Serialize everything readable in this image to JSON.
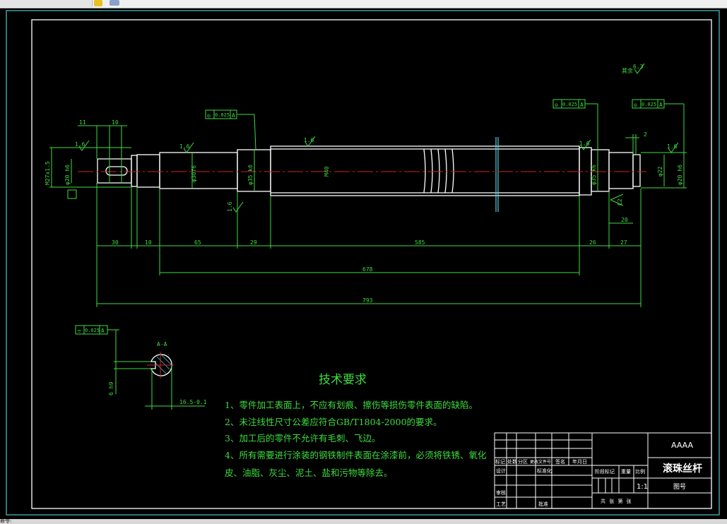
{
  "status_text": "命令:",
  "drawing": {
    "dimensions": {
      "d30": "30",
      "d10": "10",
      "d65": "65",
      "d29": "29",
      "d585": "585",
      "d26": "26",
      "d27": "27",
      "d678": "678",
      "d793": "793",
      "d11": "11",
      "d10top": "10",
      "d2": "2",
      "d20": "20",
      "d_thread": "M27x1.5",
      "d_phi20": "φ20 h6",
      "d_phi30": "φ30f6",
      "d_phi35a": "φ35 k6",
      "d_phi40": "M40",
      "d_phi35b": "φ35 k6",
      "d_phi22": "φ22",
      "d_phi20b": "φ20 h6",
      "keyway_width": "16.5-0.1",
      "keyway_depth": "6 h9"
    },
    "roughness": {
      "r1": "1.6",
      "r2": "1.6",
      "r3": "1.6",
      "r4": "1.6",
      "r5": "1.6",
      "r6": "1.6",
      "rest": "其余",
      "rest_val": "6.3",
      "chamfer": "C2"
    },
    "tolerances": {
      "t1": {
        "symbol": "◎",
        "value": "0.025",
        "datum": "A"
      },
      "t2": {
        "symbol": "◎",
        "value": "0.025",
        "datum": "A"
      },
      "t3": {
        "symbol": "◎",
        "value": "0.025",
        "datum": "A"
      },
      "t4": {
        "symbol": "⌯",
        "value": "0.025",
        "datum": "A"
      }
    },
    "datum_label": "A",
    "section_label": "A-A"
  },
  "tech_requirements": {
    "title": "技术要求",
    "items": [
      "1、零件加工表面上，不应有划痕、擦伤等损伤零件表面的缺陷。",
      "2、未注线性尺寸公差应符合GB/T1804-2000的要求。",
      "3、加工后的零件不允许有毛刺、飞边。",
      "4、所有需要进行涂装的钢铁制件表面在涂漆前，必须将铁锈、氧化",
      "皮、油脂、灰尘、泥土、盐和污物等除去。"
    ]
  },
  "title_block": {
    "company": "AAAA",
    "part_name": "滚珠丝杆",
    "drawing_no_label": "图号",
    "scale": "1:1",
    "headers": [
      "标记",
      "处数",
      "分区",
      "更改文件号",
      "签名",
      "年月日"
    ],
    "design": "设计",
    "standardize": "标准化",
    "review": "审核",
    "process": "工艺",
    "approve": "批准",
    "stage_mark": "阶段标记",
    "weight": "重量",
    "ratio": "比例",
    "sheets": "共 张 第 张"
  }
}
